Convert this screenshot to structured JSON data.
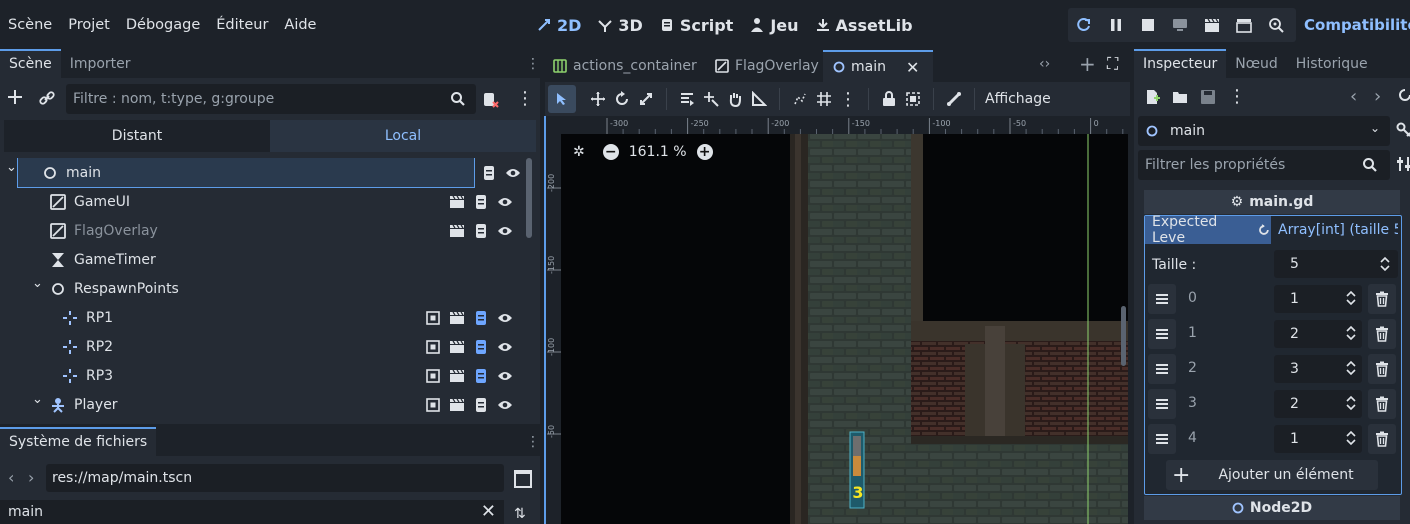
{
  "menu": [
    "Scène",
    "Projet",
    "Débogage",
    "Éditeur",
    "Aide"
  ],
  "workspaces": [
    "2D",
    "3D",
    "Script",
    "Jeu",
    "AssetLib"
  ],
  "renderer": "Compatibilité",
  "left_tabs": {
    "scene": "Scène",
    "import": "Importer"
  },
  "scene_filter_placeholder": "Filtre : nom, t:type, g:groupe",
  "scene_modes": {
    "remote": "Distant",
    "local": "Local"
  },
  "tree": [
    {
      "name": "main",
      "icon": "node-circle-icon",
      "indent": 0,
      "icons": [
        "script-icon",
        "eye-icon"
      ]
    },
    {
      "name": "GameUI",
      "icon": "control-icon",
      "indent": 1,
      "icons": [
        "clapper-icon",
        "script-icon",
        "eye-icon"
      ]
    },
    {
      "name": "FlagOverlay",
      "icon": "control-icon",
      "indent": 1,
      "dim": true,
      "icons": [
        "clapper-icon",
        "script-icon",
        "eye-icon"
      ]
    },
    {
      "name": "GameTimer",
      "icon": "hourglass-icon",
      "indent": 1,
      "icons": []
    },
    {
      "name": "RespawnPoints",
      "icon": "node-circle-icon",
      "indent": 1,
      "icons": []
    },
    {
      "name": "RP1",
      "icon": "marker2d-icon",
      "indent": 2,
      "icons": [
        "group-icon",
        "clapper-icon",
        "script-blue-icon",
        "eye-icon"
      ]
    },
    {
      "name": "RP2",
      "icon": "marker2d-icon",
      "indent": 2,
      "icons": [
        "group-icon",
        "clapper-icon",
        "script-blue-icon",
        "eye-icon"
      ]
    },
    {
      "name": "RP3",
      "icon": "marker2d-icon",
      "indent": 2,
      "icons": [
        "group-icon",
        "clapper-icon",
        "script-blue-icon",
        "eye-icon"
      ]
    },
    {
      "name": "Player",
      "icon": "character-icon",
      "indent": 1,
      "icons": [
        "group-icon",
        "clapper-icon",
        "script-icon",
        "eye-icon"
      ]
    }
  ],
  "filesystem": {
    "tab": "Système de fichiers",
    "path": "res://map/main.tscn",
    "search": "main"
  },
  "editor_tabs": [
    {
      "name": "actions_container",
      "icon": "container-icon"
    },
    {
      "name": "FlagOverlay",
      "icon": "control-icon"
    },
    {
      "name": "main",
      "icon": "node-circle-icon",
      "active": true
    }
  ],
  "toolbar": {
    "view_label": "Affichage"
  },
  "zoom": "161.1 %",
  "ruler_labels": [
    "-300",
    "-250",
    "-200",
    "-150",
    "-100",
    "-50",
    "0"
  ],
  "ruler_v_labels": [
    "-200",
    "-150",
    "-100",
    "-50"
  ],
  "inspector": {
    "tabs": [
      "Inspecteur",
      "Nœud",
      "Historique"
    ],
    "object": "main",
    "filter_placeholder": "Filtrer les propriétés",
    "script_section": "main.gd",
    "property_name": "Expected Leve",
    "property_type": "Array[int] (taille 5",
    "size_label": "Taille :",
    "size_value": "5",
    "items": [
      {
        "index": "0",
        "value": "1"
      },
      {
        "index": "1",
        "value": "2"
      },
      {
        "index": "2",
        "value": "3"
      },
      {
        "index": "3",
        "value": "2"
      },
      {
        "index": "4",
        "value": "1"
      }
    ],
    "add_label": "Ajouter un élément",
    "next_section": "Node2D"
  },
  "sprite_label": "3",
  "colors": {
    "accent": "#5d9ce8",
    "bg": "#1d2229",
    "panel": "#252b34",
    "selection": "#3a4a5e"
  }
}
